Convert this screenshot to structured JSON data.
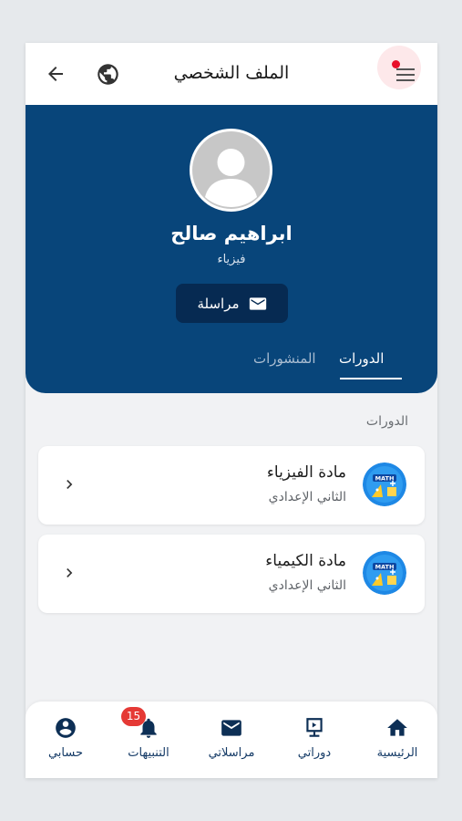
{
  "topbar": {
    "title": "الملف الشخصي",
    "back_icon": "arrow-left-icon",
    "language_icon": "globe-icon",
    "menu_icon": "hamburger-menu-icon"
  },
  "profile": {
    "name": "ابراهيم صالح",
    "subject": "فيزياء",
    "message_button": "مراسلة",
    "message_icon": "envelope-icon"
  },
  "tabs": [
    {
      "label": "الدورات",
      "active": true
    },
    {
      "label": "المنشورات",
      "active": false
    }
  ],
  "courses_section": {
    "label": "الدورات",
    "items": [
      {
        "name": "مادة الفيزياء",
        "level": "الثاني الإعدادي",
        "icon": "math-course-icon"
      },
      {
        "name": "مادة الكيمياء",
        "level": "الثاني الإعدادي",
        "icon": "math-course-icon"
      }
    ]
  },
  "bottom_nav": [
    {
      "label": "الرئيسية",
      "icon": "home-icon"
    },
    {
      "label": "دوراتي",
      "icon": "monitor-icon"
    },
    {
      "label": "مراسلاتي",
      "icon": "envelope-icon"
    },
    {
      "label": "التنبيهات",
      "icon": "bell-icon",
      "badge": "15"
    },
    {
      "label": "حسابي",
      "icon": "account-circle-icon"
    }
  ],
  "colors": {
    "primary": "#08457a",
    "dark_button": "#062a52",
    "badge": "#e53935",
    "nav_text": "#143a66"
  }
}
